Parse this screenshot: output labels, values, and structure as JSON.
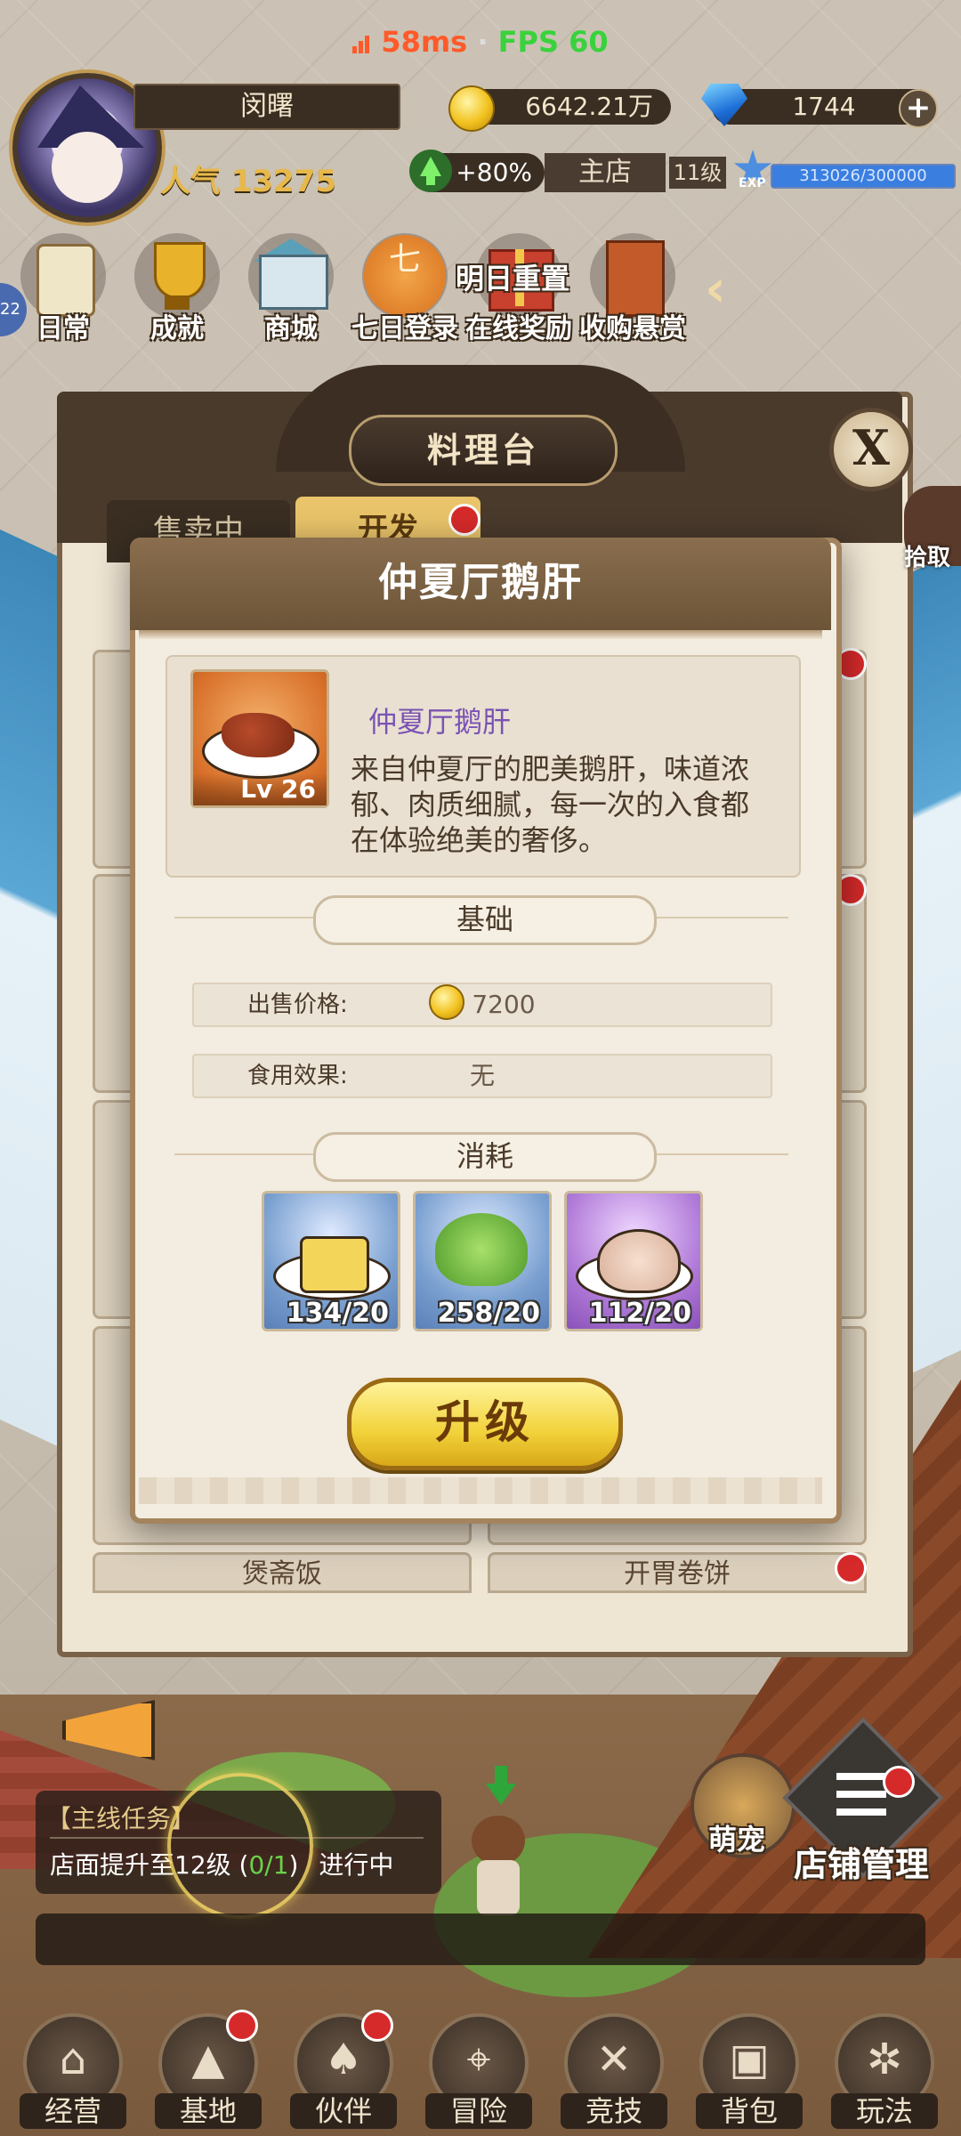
{
  "status": {
    "ping": "58ms",
    "sep": "·",
    "fps": "FPS 60"
  },
  "player": {
    "name": "闵曙",
    "gold": "6642.21万",
    "gems": "1744",
    "popularity": "人气 13275",
    "boost": "+80%",
    "shop_name": "主店",
    "shop_level": "11级",
    "exp_label": "EXP",
    "exp_text": "313026/300000",
    "exp_fraction": 1.0
  },
  "features": [
    {
      "label": "日常",
      "icon": "scroll-icon"
    },
    {
      "label": "成就",
      "icon": "trophy-icon"
    },
    {
      "label": "商城",
      "icon": "shop-icon"
    },
    {
      "label": "七日登录",
      "icon": "seven-day-icon",
      "glyph": "七"
    },
    {
      "label": "在线奖励",
      "icon": "gift-icon"
    },
    {
      "label": "收购悬赏",
      "icon": "bounty-board-icon"
    }
  ],
  "reset_label": "明日重置",
  "side_badge": "22",
  "kitchen": {
    "title": "料理台",
    "close": "X",
    "tabs": [
      "售卖中",
      "开发"
    ],
    "pickup": "拾取",
    "bottom_cards": [
      "煲斋饭",
      "开胃卷饼"
    ]
  },
  "dialog": {
    "title": "仲夏厅鹅肝",
    "item_name": "仲夏厅鹅肝",
    "item_level": "Lv 26",
    "description": "来自仲夏厅的肥美鹅肝，味道浓郁、肉质细腻，每一次的入食都在体验绝美的奢侈。",
    "section_basic": "基础",
    "price_label": "出售价格:",
    "price_value": "7200",
    "effect_label": "食用效果:",
    "effect_value": "无",
    "section_cost": "消耗",
    "materials": [
      {
        "count": "134/20",
        "icon": "butter-icon"
      },
      {
        "count": "258/20",
        "icon": "bok-choy-icon"
      },
      {
        "count": "112/20",
        "icon": "poultry-icon"
      }
    ],
    "upgrade_label": "升级"
  },
  "quest": {
    "title": "【主线任务】",
    "text_prefix": "店面提升至12级 (",
    "progress": "0/1",
    "text_suffix": ")",
    "state": "进行中"
  },
  "pet_label": "萌宠",
  "manage_label": "店铺管理",
  "nav": [
    {
      "label": "经营",
      "icon": "shop-house-icon",
      "glyph": "⌂"
    },
    {
      "label": "基地",
      "icon": "tent-icon",
      "glyph": "▲"
    },
    {
      "label": "伙伴",
      "icon": "cards-icon",
      "glyph": "♠"
    },
    {
      "label": "冒险",
      "icon": "map-icon",
      "glyph": "⌖"
    },
    {
      "label": "竞技",
      "icon": "swords-icon",
      "glyph": "✕"
    },
    {
      "label": "背包",
      "icon": "backpack-icon",
      "glyph": "▣"
    },
    {
      "label": "玩法",
      "icon": "wheel-icon",
      "glyph": "✲"
    }
  ],
  "colors": {
    "accent_gold": "#f2d23a",
    "badge_red": "#d62a2a",
    "name_purple": "#7a52b4",
    "ping_red": "#ff5a2a",
    "fps_green": "#39d23c"
  }
}
